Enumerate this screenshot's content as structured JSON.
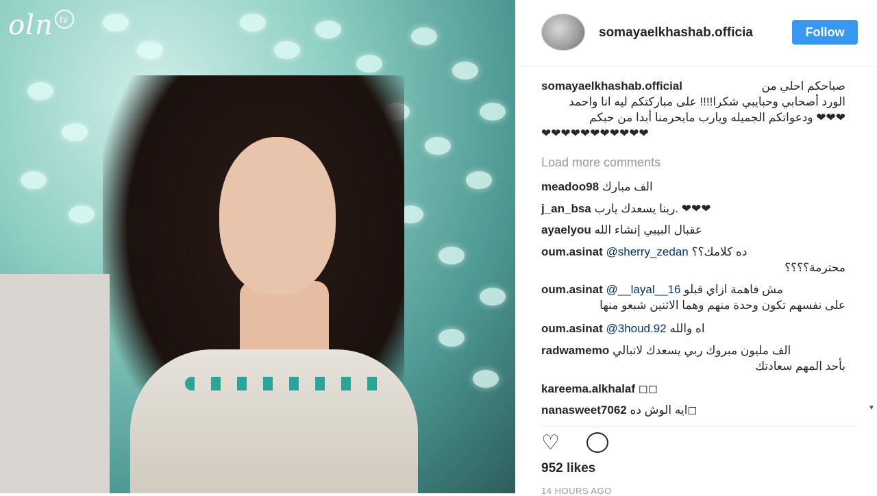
{
  "watermark": {
    "logo": "oln",
    "badge": "tv"
  },
  "post": {
    "username": "somayaelkhashab.officia",
    "follow_label": "Follow",
    "caption_username": "somayaelkhashab.official",
    "caption_text_1": "صباحكم احلي من",
    "caption_text_2": "الورد أصحابي وحبايبي شكرا!!!! على مباركتكم ليه انا واحمد",
    "caption_text_3": "❤❤❤ ودعواتكم الجميله ويارب مايحرمنا أبدا من حبكم",
    "caption_text_4": "❤❤❤❤❤❤❤❤❤❤❤",
    "load_more": "Load more comments",
    "likes": "952 likes",
    "time": "14 HOURS AGO"
  },
  "comments": [
    {
      "user": "meadoo98",
      "text": "الف مبارك"
    },
    {
      "user": "j_an_bsa",
      "text": "❤❤❤ .ربنا يسعدك يارب"
    },
    {
      "user": "ayaelyou",
      "text": "عقبال البيبي إنشاء الله"
    },
    {
      "user": "oum.asinat",
      "mention": "@sherry_zedan",
      "text": "ده كلامك؟؟",
      "text2": "محترمة؟؟؟؟"
    },
    {
      "user": "oum.asinat",
      "mention": "@__layal__16",
      "text": "مش فاهمة ازاي قبلو",
      "text2": "على نفسهم تكون وحدة منهم وهما الاثنين شبعو منها"
    },
    {
      "user": "oum.asinat",
      "mention": "@3houd.92",
      "text": "اه والله"
    },
    {
      "user": "radwamemo",
      "text": "الف مليون مبروك ربي يسعدك لاتبالي",
      "text2": "بأحد المهم سعادتك"
    },
    {
      "user": "kareema.alkhalaf",
      "text": "◻◻"
    },
    {
      "user": "nanasweet7062",
      "text": "◻ايه الوش ده"
    }
  ],
  "colors": {
    "follow_bg": "#3897f0",
    "mention": "#003569",
    "muted": "#999999"
  }
}
